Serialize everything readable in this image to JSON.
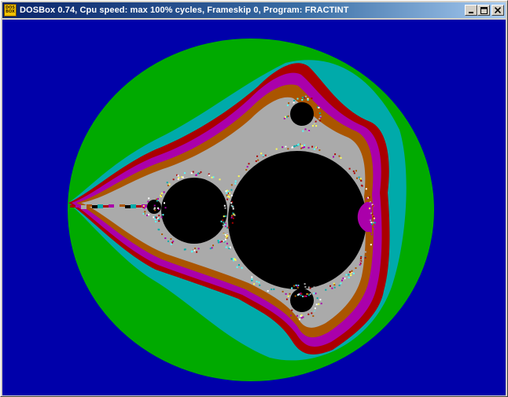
{
  "window": {
    "title": "DOSBox 0.74, Cpu speed: max 100% cycles, Frameskip  0, Program: FRACTINT",
    "icon_label_top": "DOS",
    "icon_label_bottom": "BOX",
    "icons": {
      "app": "dosbox-icon",
      "minimize": "minimize-icon",
      "maximize": "maximize-icon",
      "close": "close-icon"
    }
  },
  "colors": {
    "titlebar_start": "#0a246a",
    "titlebar_end": "#a6caf0",
    "background": "#0000aa",
    "outer_band": "#00aa00",
    "band_2": "#00aaaa",
    "band_3": "#aa0000",
    "band_4": "#aa00aa",
    "band_5": "#aa5500",
    "band_6": "#aaaaaa",
    "set_interior": "#000000"
  }
}
